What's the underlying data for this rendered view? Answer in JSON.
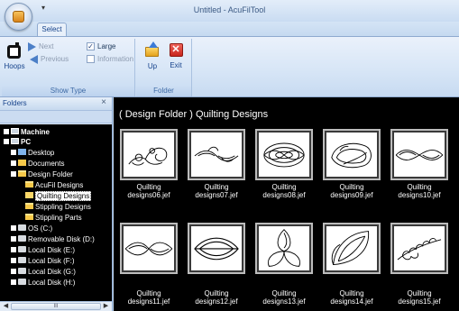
{
  "app": {
    "window_title": "Untitled - AcuFilTool",
    "qat_glyph": "▾",
    "tab": "Select"
  },
  "ribbon": {
    "show_type_group": {
      "label": "Show Type",
      "hoops": "Hoops",
      "next": "Next",
      "previous": "Previous",
      "large": "Large",
      "large_checked": true,
      "information": "Information",
      "information_checked": false,
      "check_glyph": "✓"
    },
    "folder_group": {
      "label": "Folder",
      "up": "Up",
      "exit": "Exit",
      "exit_glyph": "✕"
    }
  },
  "folders_panel": {
    "title": "Folders",
    "close_glyph": "×",
    "tree": {
      "machine": "Machine",
      "pc": "PC",
      "desktop": "Desktop",
      "documents": "Documents",
      "design_folder": "Design Folder",
      "acufil_designs": "AcuFil Designs",
      "quilting_designs": "Quilting Designs",
      "stippling_designs": "Stippling Designs",
      "stippling_parts": "Stippling Parts",
      "os_c": "OS (C:)",
      "removable_d": "Removable Disk (D:)",
      "local_e": "Local Disk (E:)",
      "local_f": "Local Disk (F:)",
      "local_g": "Local Disk (G:)",
      "local_h": "Local Disk (H:)"
    },
    "scroll": {
      "left": "◀",
      "right": "▶",
      "thumb": "III"
    }
  },
  "main": {
    "title": "( Design Folder ) Quilting Designs",
    "designs": [
      {
        "line1": "Quilting",
        "line2": "designs06.jef"
      },
      {
        "line1": "Quilting",
        "line2": "designs07.jef"
      },
      {
        "line1": "Quilting",
        "line2": "designs08.jef"
      },
      {
        "line1": "Quilting",
        "line2": "designs09.jef"
      },
      {
        "line1": "Quilting",
        "line2": "designs10.jef"
      },
      {
        "line1": "Quilting",
        "line2": "designs11.jef"
      },
      {
        "line1": "Quilting",
        "line2": "designs12.jef"
      },
      {
        "line1": "Quilting",
        "line2": "designs13.jef"
      },
      {
        "line1": "Quilting",
        "line2": "designs14.jef"
      },
      {
        "line1": "Quilting",
        "line2": "designs15.jef"
      }
    ]
  }
}
